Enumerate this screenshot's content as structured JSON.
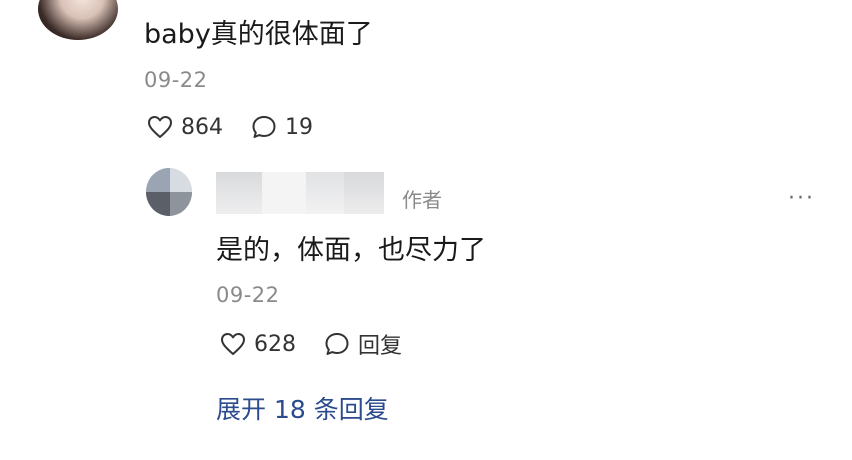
{
  "main_comment": {
    "text": "baby真的很体面了",
    "date": "09-22",
    "likes": "864",
    "replies": "19"
  },
  "reply": {
    "author_tag": "作者",
    "more": "···",
    "text": "是的，体面，也尽力了",
    "date": "09-22",
    "likes": "628",
    "reply_label": "回复"
  },
  "expand_label": "展开 18 条回复"
}
